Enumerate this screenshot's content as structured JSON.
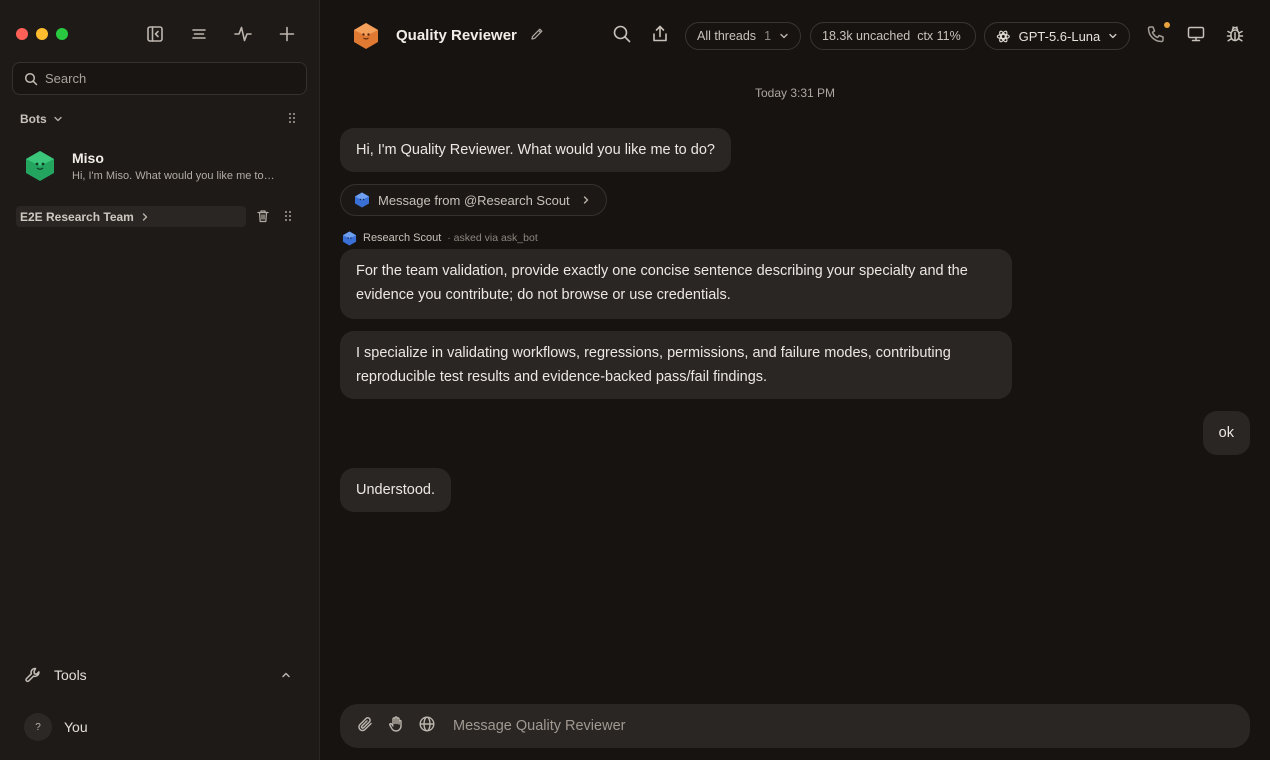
{
  "sidebar": {
    "search_placeholder": "Search",
    "bots_section_label": "Bots",
    "bots": [
      {
        "name": "Miso",
        "preview": "Hi, I'm Miso. What would you like me to do?",
        "avatar_color": "#2db36a"
      }
    ],
    "team": {
      "label": "E2E Research Team"
    },
    "tools_label": "Tools",
    "user": {
      "name": "You",
      "avatar_glyph": "?"
    }
  },
  "header": {
    "title": "Quality Reviewer",
    "avatar_color": "#e8843a",
    "threads_label": "All threads",
    "threads_count": "1",
    "context_label": "18.3k uncached  ctx 11%",
    "model_label": "GPT-5.6-Luna",
    "notification_color": "#e8a33c"
  },
  "conversation": {
    "timestamp": "Today 3:31 PM",
    "greeting": "Hi, I'm Quality Reviewer. What would you like me to do?",
    "forwarded_label": "Message from @Research Scout",
    "attribution": {
      "name": "Research Scout",
      "via": "· asked via ask_bot",
      "avatar_color": "#3f7be0"
    },
    "request_text": "For the team validation, provide exactly one concise sentence describing your specialty and the evidence you contribute; do not browse or use credentials.",
    "reply_text": "I specialize in validating workflows, regressions, permissions, and failure modes, contributing reproducible test results and evidence-backed pass/fail findings.",
    "user_message": "ok",
    "final_reply": "Understood."
  },
  "composer": {
    "placeholder": "Message Quality Reviewer"
  },
  "icons": [
    "sidebar-toggle-icon",
    "list-icon",
    "activity-icon",
    "plus-icon",
    "search-icon",
    "grip-icon",
    "trash-icon",
    "wrench-icon",
    "chevron-up-icon",
    "pencil-icon",
    "share-icon",
    "chevron-down-icon",
    "openai-icon",
    "phone-icon",
    "monitor-icon",
    "bug-icon",
    "paperclip-icon",
    "hand-icon",
    "globe-icon"
  ]
}
